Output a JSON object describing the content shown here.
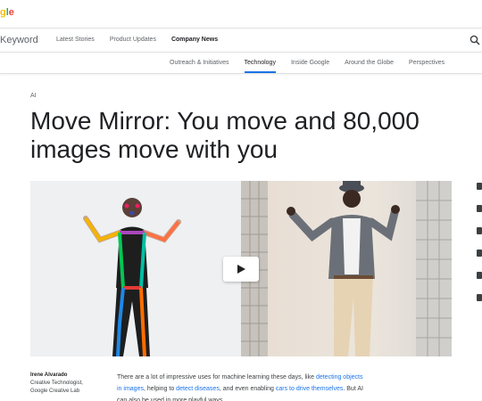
{
  "header": {
    "logo_text": "gle",
    "brand": "Keyword",
    "nav": [
      "Latest Stories",
      "Product Updates",
      "Company News"
    ],
    "nav_active": "Company News"
  },
  "subnav": {
    "items": [
      "Outreach & Initiatives",
      "Technology",
      "Inside Google",
      "Around the Globe",
      "Perspectives"
    ],
    "active": "Technology"
  },
  "article": {
    "category": "AI",
    "title": "Move Mirror: You move and 80,000 images move with you",
    "author": {
      "name": "Irene Alvarado",
      "role": "Creative Technologist,",
      "org": "Google Creative Lab"
    },
    "body": {
      "p1": "There are a lot of impressive uses for machine learning these days, like ",
      "link1": "detecting objects in images",
      "p2": ", helping to ",
      "link2": "detect diseases",
      "p3": ", and even enabling ",
      "link3": "cars to drive themselves",
      "p4": ". But AI can also be used in more playful ways."
    }
  },
  "icons": {
    "search": "search-icon",
    "play": "play-icon",
    "share": [
      "share-icon",
      "bookmark-icon",
      "twitter-icon",
      "facebook-icon",
      "email-icon",
      "link-icon"
    ]
  },
  "colors": {
    "accent": "#1a73e8",
    "text": "#202124",
    "muted": "#5f6368"
  }
}
